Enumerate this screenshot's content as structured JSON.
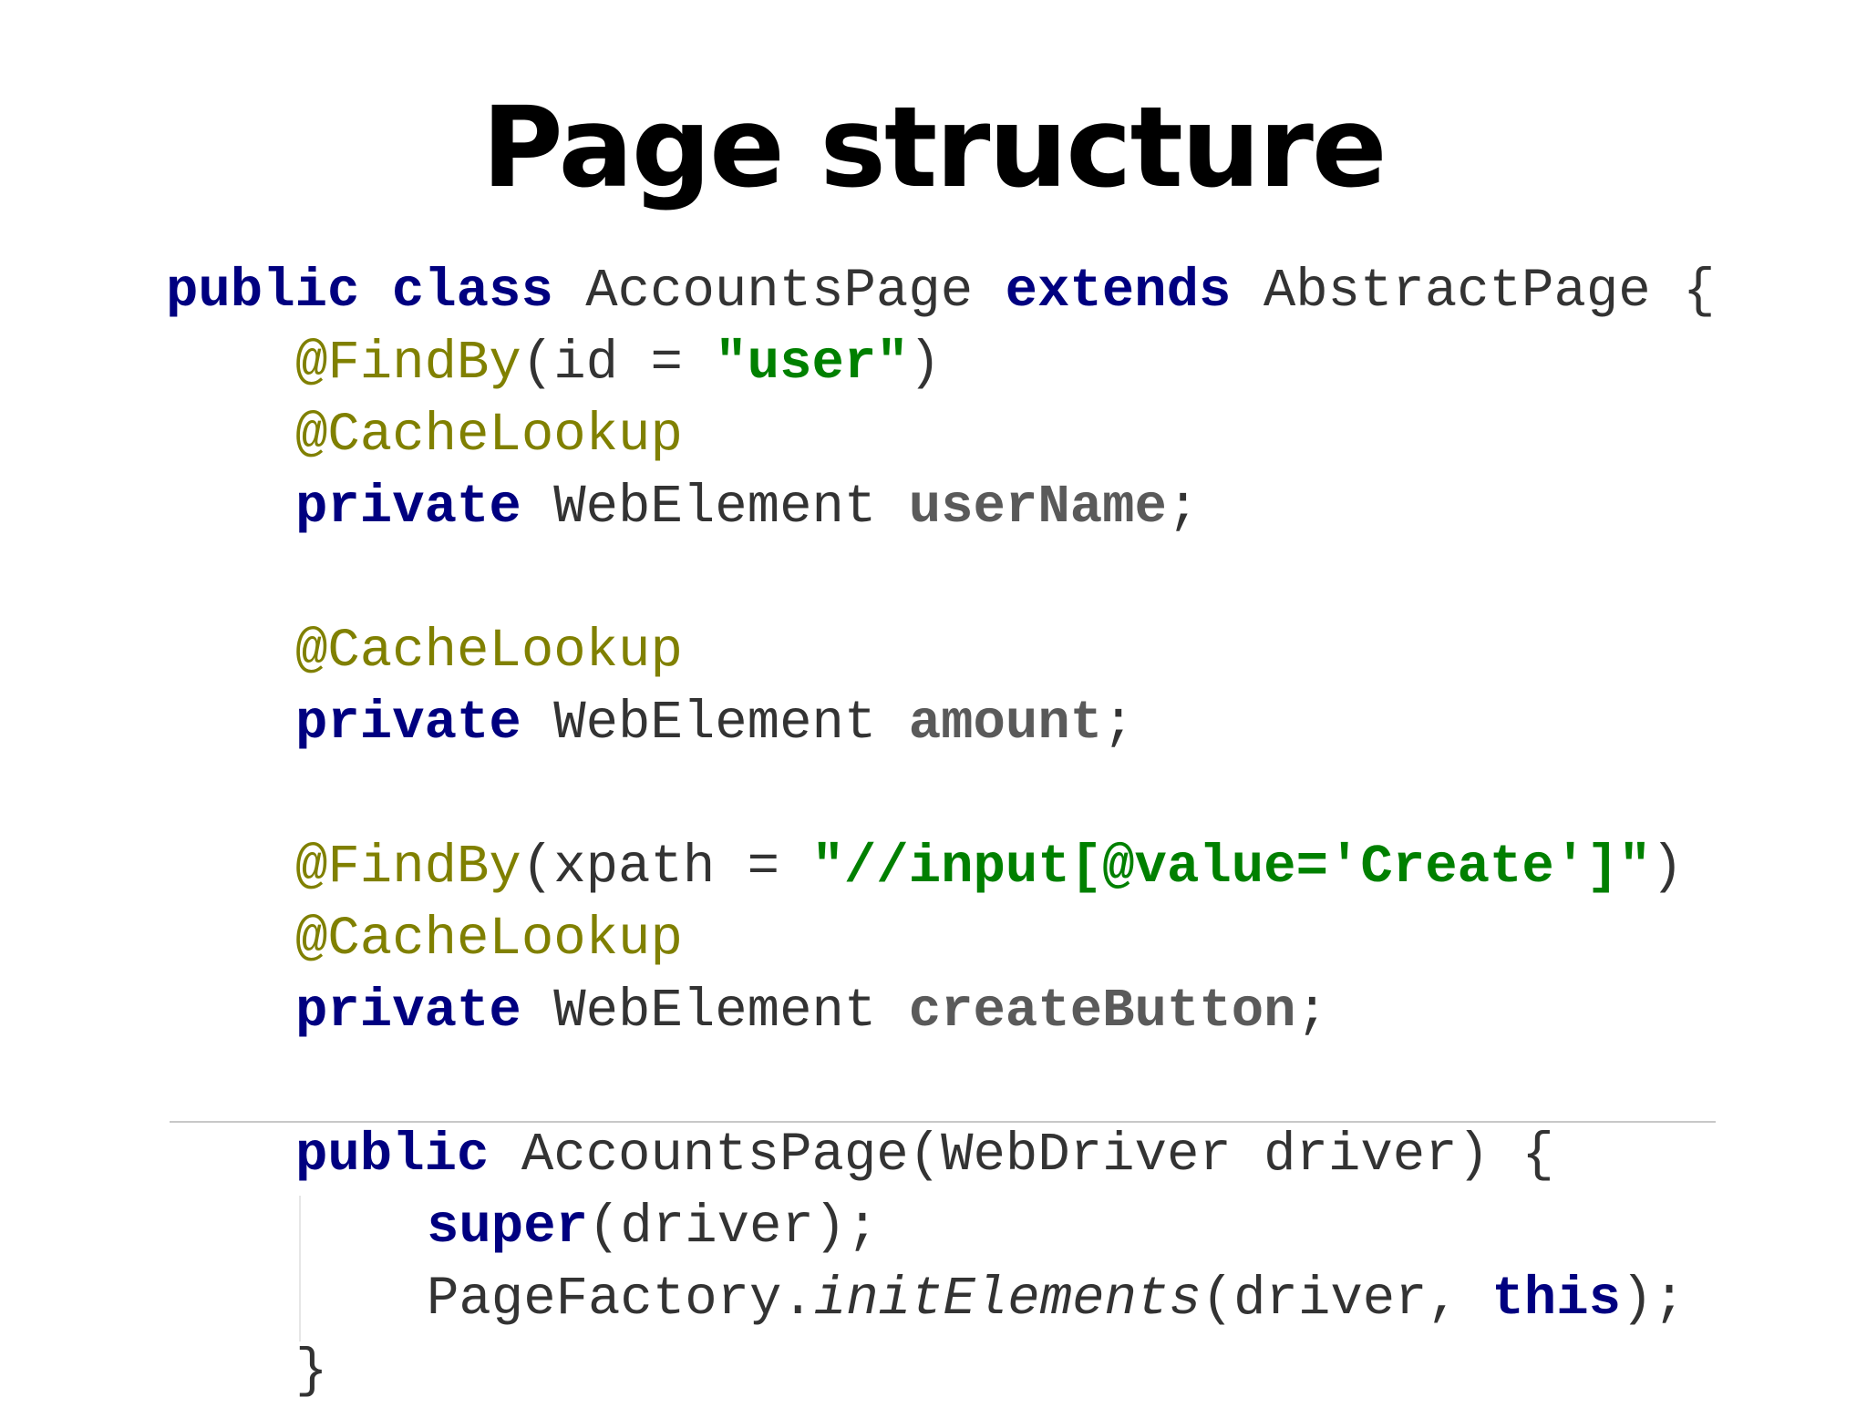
{
  "slide": {
    "title": "Page structure"
  },
  "code": {
    "line1": {
      "kw_public": "public",
      "kw_class": "class",
      "class_name": "AccountsPage",
      "kw_extends": "extends",
      "parent_name": "AbstractPage",
      "brace": "{"
    },
    "line2": {
      "annotation": "@FindBy",
      "open": "(id = ",
      "string": "\"user\"",
      "close": ")"
    },
    "line3": {
      "annotation": "@CacheLookup"
    },
    "line4": {
      "kw_private": "private",
      "type": "WebElement",
      "field": "userName",
      "semi": ";"
    },
    "line5": {
      "annotation": "@CacheLookup"
    },
    "line6": {
      "kw_private": "private",
      "type": "WebElement",
      "field": "amount",
      "semi": ";"
    },
    "line7": {
      "annotation": "@FindBy",
      "open": "(xpath = ",
      "string": "\"//input[@value='Create']\"",
      "close": ")"
    },
    "line8": {
      "annotation": "@CacheLookup"
    },
    "line9": {
      "kw_private": "private",
      "type": "WebElement",
      "field": "createButton",
      "semi": ";"
    },
    "line10": {
      "kw_public": "public",
      "signature": "AccountsPage(WebDriver driver) {"
    },
    "line11": {
      "kw_super": "super",
      "args": "(driver);"
    },
    "line12": {
      "receiver": "PageFactory.",
      "method": "initElements",
      "args_open": "(driver, ",
      "kw_this": "this",
      "args_close": ");"
    },
    "line13": {
      "brace": "}"
    }
  },
  "colors": {
    "keyword": "#000080",
    "annotation": "#808000",
    "string": "#008000",
    "field": "#5a5a5a",
    "plain": "#333333"
  }
}
